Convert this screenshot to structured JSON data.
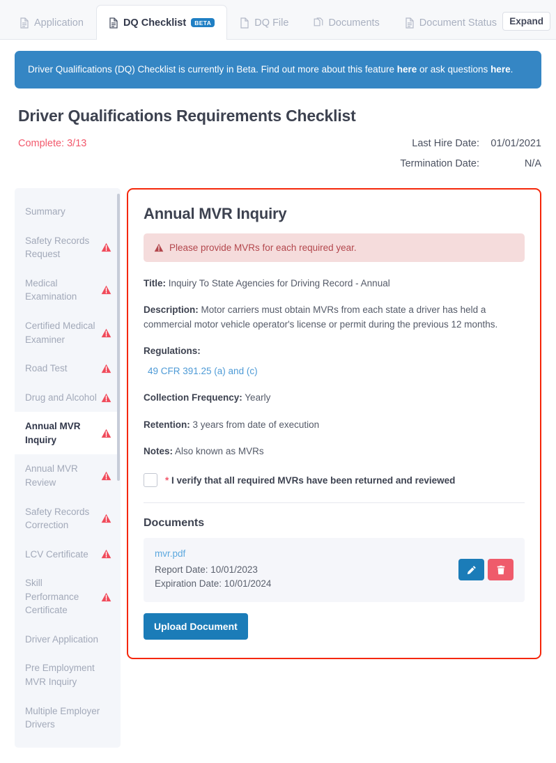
{
  "tabs": [
    {
      "label": "Application",
      "icon": "file-text-icon",
      "active": false,
      "badge": null
    },
    {
      "label": "DQ Checklist",
      "icon": "file-text-icon",
      "active": true,
      "badge": "BETA"
    },
    {
      "label": "DQ File",
      "icon": "file-icon",
      "active": false,
      "badge": null
    },
    {
      "label": "Documents",
      "icon": "copy-files-icon",
      "active": false,
      "badge": null
    },
    {
      "label": "Document Status",
      "icon": "file-text-icon",
      "active": false,
      "badge": null
    }
  ],
  "expand_button": "Expand",
  "notice": {
    "text_before": "Driver Qualifications (DQ) Checklist is currently in Beta. Find out more about this feature ",
    "link1": "here",
    "text_middle": " or ask questions ",
    "link2": "here",
    "text_after": ".",
    "color": "#3586c4"
  },
  "page_title": "Driver Qualifications Requirements Checklist",
  "complete_label": "Complete: 3/13",
  "complete_color": "#f2596c",
  "dates": [
    {
      "label": "Last Hire Date:",
      "value": "01/01/2021"
    },
    {
      "label": "Termination Date:",
      "value": "N/A"
    }
  ],
  "sidebar": {
    "items": [
      {
        "label": "Summary",
        "warning": false,
        "active": false
      },
      {
        "label": "Safety Records Request",
        "warning": true,
        "active": false
      },
      {
        "label": "Medical Examination",
        "warning": true,
        "active": false
      },
      {
        "label": "Certified Medical Examiner",
        "warning": true,
        "active": false
      },
      {
        "label": "Road Test",
        "warning": true,
        "active": false
      },
      {
        "label": "Drug and Alcohol",
        "warning": true,
        "active": false
      },
      {
        "label": "Annual MVR Inquiry",
        "warning": true,
        "active": true
      },
      {
        "label": "Annual MVR Review",
        "warning": true,
        "active": false
      },
      {
        "label": "Safety Records Correction",
        "warning": true,
        "active": false
      },
      {
        "label": "LCV Certificate",
        "warning": true,
        "active": false
      },
      {
        "label": "Skill Performance Certificate",
        "warning": true,
        "active": false
      },
      {
        "label": "Driver Application",
        "warning": false,
        "active": false
      },
      {
        "label": "Pre Employment MVR Inquiry",
        "warning": false,
        "active": false
      },
      {
        "label": "Multiple Employer Drivers",
        "warning": false,
        "active": false
      }
    ]
  },
  "panel": {
    "title": "Annual MVR Inquiry",
    "alert": "Please provide MVRs for each required year.",
    "alert_bg": "#f5dcdc",
    "alert_color": "#b3474d",
    "border_color": "#f5270a",
    "fields": {
      "title_label": "Title:",
      "title_value": "Inquiry To State Agencies for Driving Record - Annual",
      "description_label": "Description:",
      "description_value": "Motor carriers must obtain MVRs from each state a driver has held a commercial motor vehicle operator's license or permit during the previous 12 months.",
      "regulations_label": "Regulations:",
      "regulations_link": "49 CFR 391.25 (a) and (c)",
      "collection_frequency_label": "Collection Frequency:",
      "collection_frequency_value": "Yearly",
      "retention_label": "Retention:",
      "retention_value": "3 years from date of execution",
      "notes_label": "Notes:",
      "notes_value": "Also known as MVRs"
    },
    "verify": {
      "required_mark": "*",
      "label": "I verify that all required MVRs have been returned and reviewed",
      "checked": false
    },
    "documents": {
      "heading": "Documents",
      "items": [
        {
          "name": "mvr.pdf",
          "report_date": "Report Date: 10/01/2023",
          "expiration_date": "Expiration Date: 10/01/2024",
          "edit_icon": "pencil-icon",
          "delete_icon": "trash-icon"
        }
      ],
      "upload_button": "Upload Document"
    }
  }
}
